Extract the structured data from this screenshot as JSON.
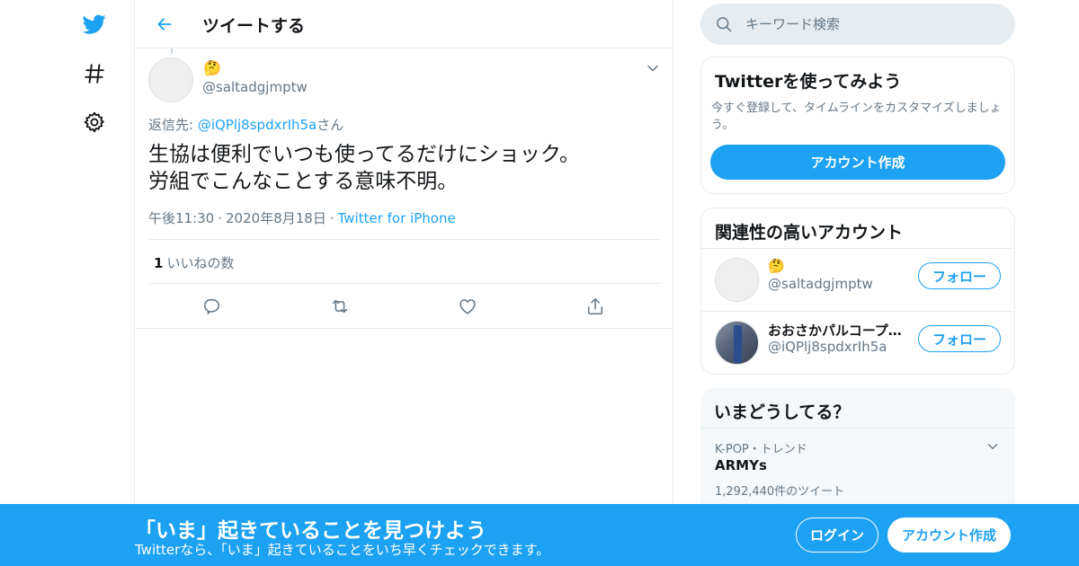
{
  "nav": {
    "icons": [
      "twitter-bird-icon",
      "hashtag-icon",
      "settings-gear-icon"
    ]
  },
  "header": {
    "title": "ツイートする"
  },
  "tweet": {
    "emoji": "🤔",
    "handle": "@saltadgjmptw",
    "reply_prefix": "返信先: ",
    "reply_to": "@iQPlj8spdxrIh5a",
    "reply_suffix": "さん",
    "text": "生協は便利でいつも使ってるだけにショック。\n労組でこんなことする意味不明。",
    "time": "午後11:30",
    "date": "2020年8月18日",
    "source": "Twitter for iPhone",
    "likes_count": "1",
    "likes_label": "いいねの数"
  },
  "search": {
    "placeholder": "キーワード検索"
  },
  "signup_card": {
    "title": "Twitterを使ってみよう",
    "description": "今すぐ登録して、タイムラインをカスタマイズしましょう。",
    "button": "アカウント作成"
  },
  "related": {
    "title": "関連性の高いアカウント",
    "users": [
      {
        "name": "🤔",
        "handle": "@saltadgjmptw",
        "follow": "フォロー"
      },
      {
        "name": "おおさかパルコープ…",
        "handle": "@iQPlj8spdxrIh5a",
        "follow": "フォロー"
      }
    ]
  },
  "trends": {
    "title": "いまどうしてる？",
    "items": [
      {
        "meta": "K-POP・トレンド",
        "name": "ARMYs",
        "count": "1,292,440件のツイート"
      }
    ]
  },
  "banner": {
    "title": "「いま」起きていることを見つけよう",
    "subtitle": "Twitterなら、「いま」起きていることをいち早くチェックできます。",
    "login": "ログイン",
    "signup": "アカウント作成"
  },
  "colors": {
    "accent": "#1da1f2",
    "border": "#e6ecf0",
    "muted": "#657786"
  }
}
